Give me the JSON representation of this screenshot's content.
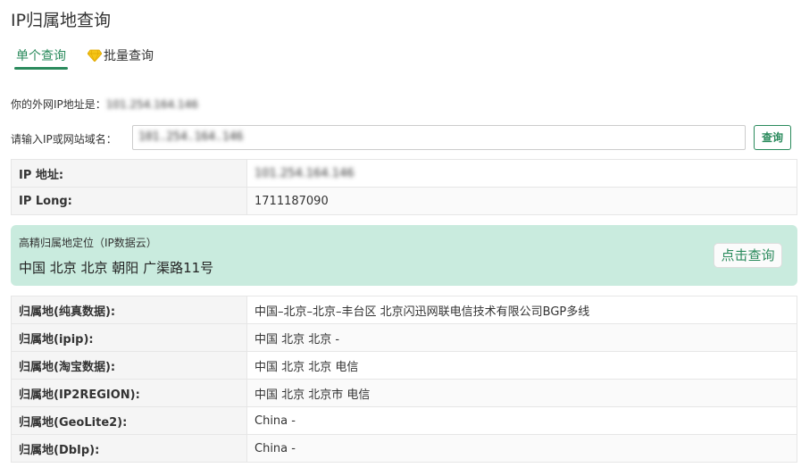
{
  "page": {
    "title": "IP归属地查询"
  },
  "tabs": [
    {
      "label": "单个查询"
    },
    {
      "label": "批量查询"
    }
  ],
  "my_ip": {
    "label": "你的外网IP地址是：",
    "value": "101.254.164.146"
  },
  "query": {
    "label": "请输入IP或网站域名：",
    "value": "101.254.164.146",
    "button": "查询"
  },
  "basic": [
    {
      "key": "IP 地址:",
      "value": "101.254.164.146"
    },
    {
      "key": "IP Long:",
      "value": "1711187090"
    }
  ],
  "geo": {
    "label": "高精归属地定位（IP数据云）",
    "location": "中国 北京 北京 朝阳 广渠路11号",
    "button": "点击查询"
  },
  "sources": [
    {
      "key": "归属地(纯真数据):",
      "value": "中国–北京–北京–丰台区 北京闪迅网联电信技术有限公司BGP多线"
    },
    {
      "key": "归属地(ipip):",
      "value": "中国 北京 北京 -"
    },
    {
      "key": "归属地(淘宝数据):",
      "value": "中国 北京 北京 电信"
    },
    {
      "key": "归属地(IP2REGION):",
      "value": "中国 北京 北京市 电信"
    },
    {
      "key": "归属地(GeoLite2):",
      "value": "China -"
    },
    {
      "key": "归属地(DbIp):",
      "value": "China -"
    }
  ],
  "colors": {
    "accent": "#2a8a5c",
    "geo_bg": "#c9ebde",
    "diamond": "#f5c518"
  }
}
